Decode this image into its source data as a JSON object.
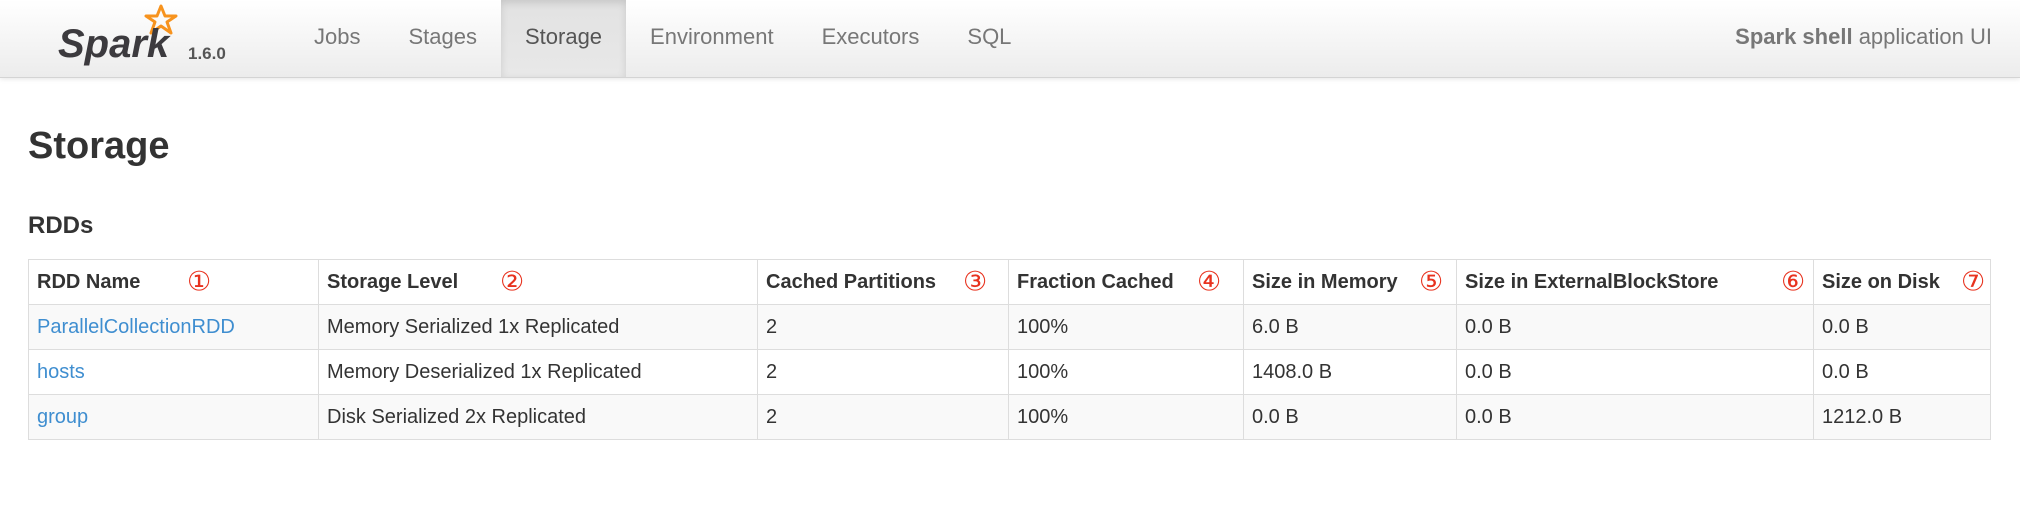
{
  "brand": {
    "name": "Spark",
    "version": "1.6.0",
    "star_color": "#f7931e"
  },
  "nav": {
    "items": [
      {
        "label": "Jobs",
        "active": false
      },
      {
        "label": "Stages",
        "active": false
      },
      {
        "label": "Storage",
        "active": true
      },
      {
        "label": "Environment",
        "active": false
      },
      {
        "label": "Executors",
        "active": false
      },
      {
        "label": "SQL",
        "active": false
      }
    ]
  },
  "app": {
    "name_bold": "Spark shell",
    "suffix": "application UI"
  },
  "page": {
    "title": "Storage",
    "section": "RDDs"
  },
  "table": {
    "columns": [
      {
        "label": "RDD Name",
        "marker": "①"
      },
      {
        "label": "Storage Level",
        "marker": "②"
      },
      {
        "label": "Cached Partitions",
        "marker": "③"
      },
      {
        "label": "Fraction Cached",
        "marker": "④"
      },
      {
        "label": "Size in Memory",
        "marker": "⑤"
      },
      {
        "label": "Size in ExternalBlockStore",
        "marker": "⑥"
      },
      {
        "label": "Size on Disk",
        "marker": "⑦"
      }
    ],
    "rows": [
      {
        "name": "ParallelCollectionRDD",
        "storage_level": "Memory Serialized 1x Replicated",
        "cached_partitions": "2",
        "fraction_cached": "100%",
        "size_in_memory": "6.0 B",
        "size_in_external": "0.0 B",
        "size_on_disk": "0.0 B"
      },
      {
        "name": "hosts",
        "storage_level": "Memory Deserialized 1x Replicated",
        "cached_partitions": "2",
        "fraction_cached": "100%",
        "size_in_memory": "1408.0 B",
        "size_in_external": "0.0 B",
        "size_on_disk": "0.0 B"
      },
      {
        "name": "group",
        "storage_level": "Disk Serialized 2x Replicated",
        "cached_partitions": "2",
        "fraction_cached": "100%",
        "size_in_memory": "0.0 B",
        "size_in_external": "0.0 B",
        "size_on_disk": "1212.0 B"
      }
    ]
  },
  "colors": {
    "link": "#3f8ed0",
    "marker": "#e8321e"
  }
}
